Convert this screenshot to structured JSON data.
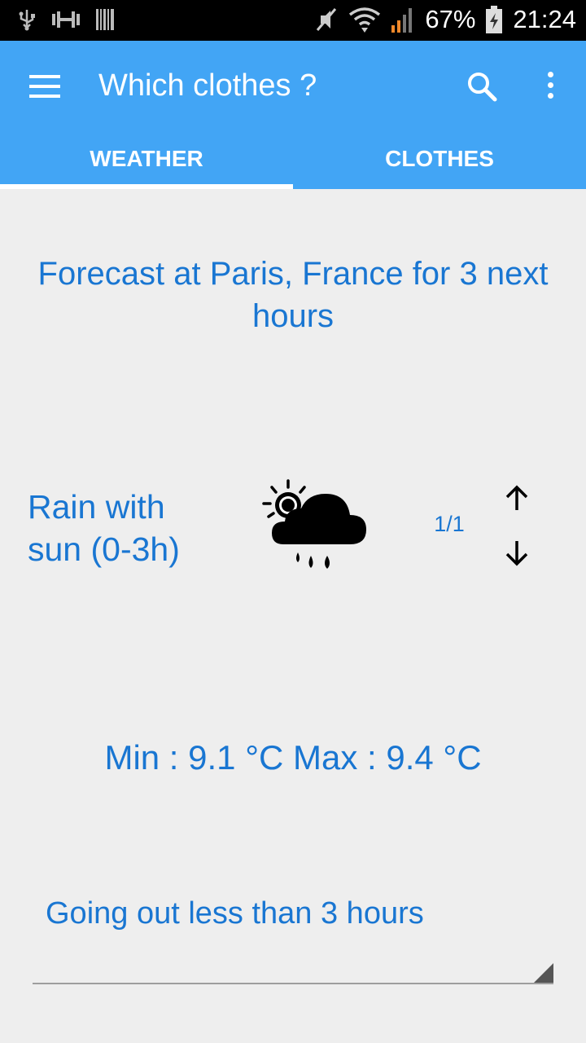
{
  "status_bar": {
    "battery_percent": "67%",
    "time": "21:24"
  },
  "app_bar": {
    "title": "Which clothes ?"
  },
  "tabs": [
    {
      "label": "WEATHER",
      "selected": true
    },
    {
      "label": "CLOTHES",
      "selected": false
    }
  ],
  "forecast": {
    "title": "Forecast at Paris, France for 3 next hours",
    "condition": "Rain with sun (0-3h)",
    "condition_icon": "sun-rain-cloud-icon",
    "page_counter": "1/1",
    "temperature": "Min : 9.1 °C Max : 9.4 °C"
  },
  "duration_select": {
    "value": "Going out less than 3 hours"
  },
  "colors": {
    "app_bar": "#42a5f5",
    "text_accent": "#1976d2",
    "background": "#eeeeee"
  }
}
